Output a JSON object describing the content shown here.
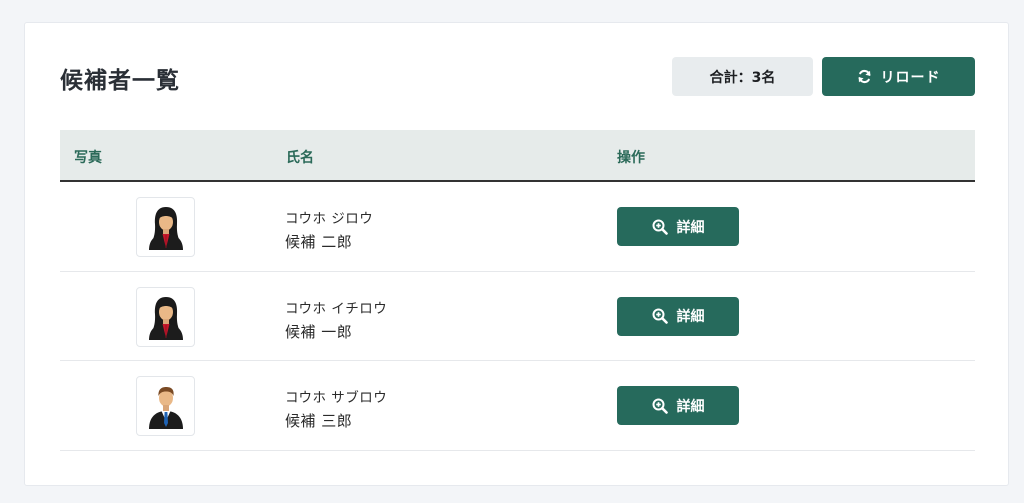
{
  "header": {
    "title": "候補者一覧",
    "total_label": "合計：3名",
    "reload_label": "リロード",
    "reload_icon": "refresh-icon"
  },
  "table": {
    "columns": [
      "写真",
      "氏名",
      "操作"
    ],
    "rows": [
      {
        "kana": "コウホ ジロウ",
        "kanji": "候補 二郎",
        "avatar": "female-avatar",
        "action_label": "詳細",
        "action_icon": "zoom-in-icon"
      },
      {
        "kana": "コウホ イチロウ",
        "kanji": "候補 一郎",
        "avatar": "female-avatar",
        "action_label": "詳細",
        "action_icon": "zoom-in-icon"
      },
      {
        "kana": "コウホ サブロウ",
        "kanji": "候補 三郎",
        "avatar": "male-avatar",
        "action_label": "詳細",
        "action_icon": "zoom-in-icon"
      }
    ]
  },
  "colors": {
    "accent": "#266a5c",
    "header_text": "#2b6a59",
    "header_bg": "#e6ebea",
    "badge_bg": "#e8ecee",
    "page_bg": "#f3f5f8"
  }
}
